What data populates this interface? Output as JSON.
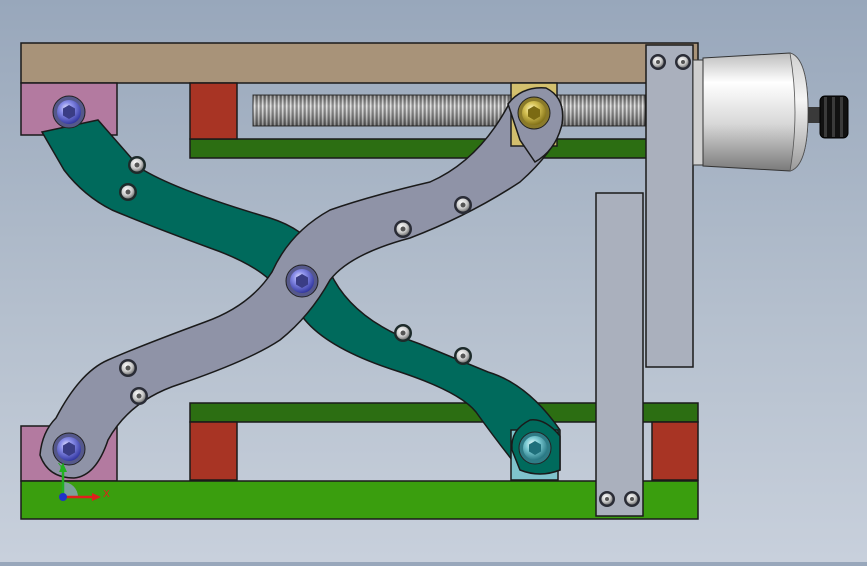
{
  "viewport": {
    "background_top": "#98a7bb",
    "background_bottom": "#c8d0dc"
  },
  "model": {
    "top_plate_color": "#a89379",
    "base_plate_color": "#3a9e0e",
    "rail_color": "#2c6e12",
    "block_red_color": "#a83424",
    "pivot_block_pink_color": "#b37aa0",
    "nut_yellow_color": "#d6c16a",
    "slider_cyan_color": "#7fc3cc",
    "arm_teal_color": "#006a5c",
    "arm_gray_color": "#8f93a7",
    "post_gray_color": "#aab0bd",
    "motor_housing_color": "#e6e6e6",
    "knob_color": "#111111",
    "lead_screw_color": "#9a9a9a",
    "center_pin_color": "#5b5fbf"
  },
  "triad": {
    "x_label": "X",
    "y_label": "Y",
    "x_color": "#e0201c",
    "y_color": "#23b021",
    "z_color": "#2033c8"
  }
}
